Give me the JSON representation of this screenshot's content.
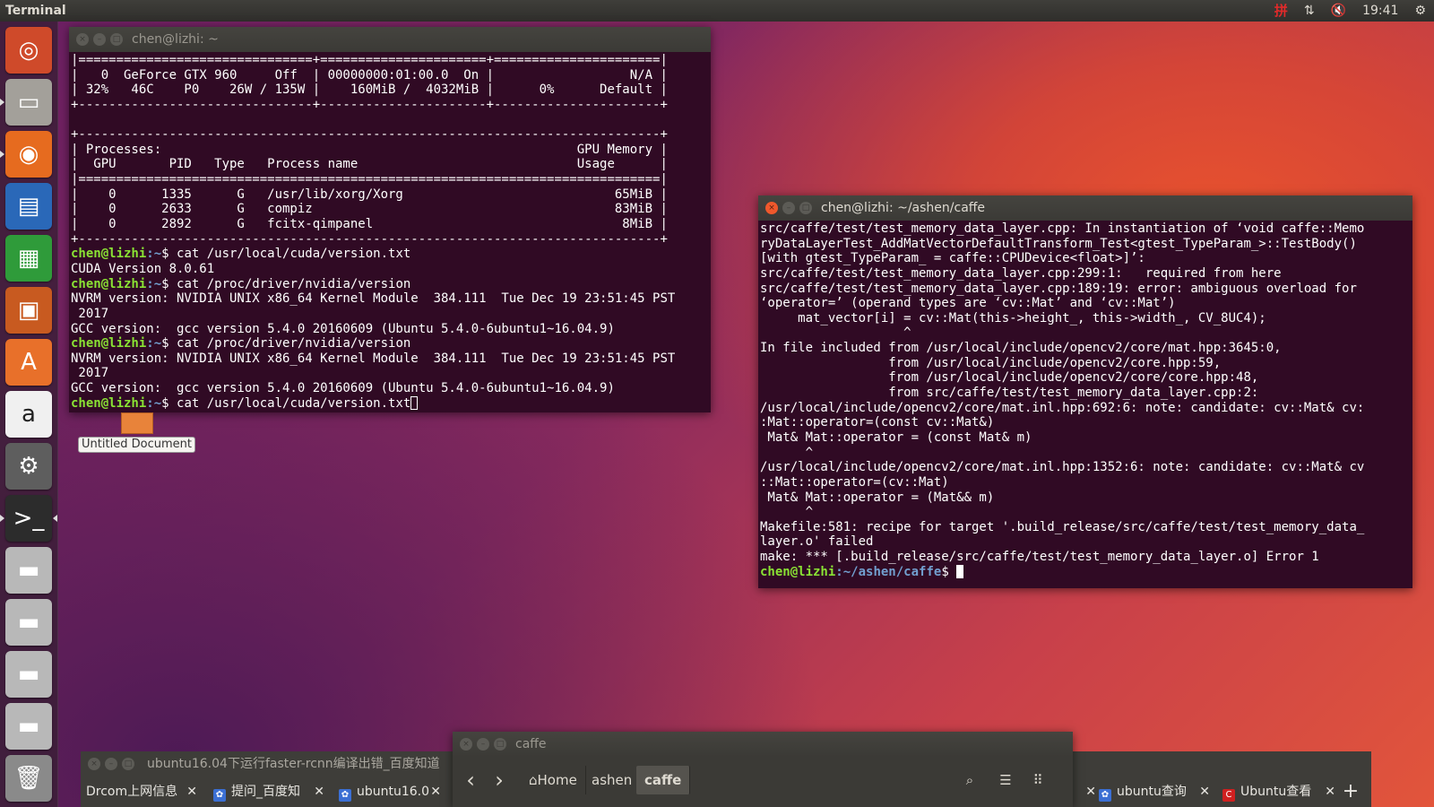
{
  "top_panel": {
    "app_title": "Terminal",
    "ime_label": "拼",
    "network_icon": "network-updown-icon",
    "volume_icon": "volume-muted-icon",
    "time": "19:41",
    "settings_icon": "gear-icon"
  },
  "launcher": {
    "items": [
      {
        "name": "ubuntu-dash-icon",
        "glyph": "◎",
        "bg": "#cf4a2a"
      },
      {
        "name": "files-icon",
        "glyph": "▭",
        "bg": "#a3a09a"
      },
      {
        "name": "firefox-icon",
        "glyph": "◉",
        "bg": "#e66b1f"
      },
      {
        "name": "libreoffice-writer-icon",
        "glyph": "▤",
        "bg": "#2a68b8"
      },
      {
        "name": "libreoffice-calc-icon",
        "glyph": "▦",
        "bg": "#2f9b3a"
      },
      {
        "name": "libreoffice-impress-icon",
        "glyph": "▣",
        "bg": "#c85a20"
      },
      {
        "name": "software-center-icon",
        "glyph": "A",
        "bg": "#e8702a"
      },
      {
        "name": "amazon-icon",
        "glyph": "a",
        "bg": "#f0f0f0"
      },
      {
        "name": "system-settings-icon",
        "glyph": "⚙",
        "bg": "#5e5e5e"
      },
      {
        "name": "terminal-icon",
        "glyph": ">_",
        "bg": "#2c2c2c"
      },
      {
        "name": "drive-icon",
        "glyph": "▬",
        "bg": "#b8b8b8"
      },
      {
        "name": "drive-icon",
        "glyph": "▬",
        "bg": "#b8b8b8"
      },
      {
        "name": "drive-icon",
        "glyph": "▬",
        "bg": "#b8b8b8"
      },
      {
        "name": "drive-icon",
        "glyph": "▬",
        "bg": "#b8b8b8"
      },
      {
        "name": "trash-icon",
        "glyph": "🗑",
        "bg": "#8a8a8a"
      }
    ]
  },
  "terminal1": {
    "title": "chen@lizhi: ~",
    "lines": [
      "|===============================+======================+======================|",
      "|   0  GeForce GTX 960     Off  | 00000000:01:00.0  On |                  N/A |",
      "| 32%   46C    P0    26W / 135W |    160MiB /  4032MiB |      0%      Default |",
      "+-------------------------------+----------------------+----------------------+",
      "",
      "+-----------------------------------------------------------------------------+",
      "| Processes:                                                       GPU Memory |",
      "|  GPU       PID   Type   Process name                             Usage      |",
      "|=============================================================================|",
      "|    0      1335      G   /usr/lib/xorg/Xorg                            65MiB |",
      "|    0      2633      G   compiz                                        83MiB |",
      "|    0      2892      G   fcitx-qimpanel                                 8MiB |",
      "+-----------------------------------------------------------------------------+"
    ],
    "after": [
      {
        "prompt_user": "chen@lizhi",
        "prompt_path": ":~",
        "prompt_end": "$ ",
        "cmd": "cat /usr/local/cuda/version.txt"
      },
      {
        "text": "CUDA Version 8.0.61"
      },
      {
        "prompt_user": "chen@lizhi",
        "prompt_path": ":~",
        "prompt_end": "$ ",
        "cmd": "cat /proc/driver/nvidia/version"
      },
      {
        "text": "NVRM version: NVIDIA UNIX x86_64 Kernel Module  384.111  Tue Dec 19 23:51:45 PST"
      },
      {
        "text": " 2017"
      },
      {
        "text": "GCC version:  gcc version 5.4.0 20160609 (Ubuntu 5.4.0-6ubuntu1~16.04.9)"
      },
      {
        "prompt_user": "chen@lizhi",
        "prompt_path": ":~",
        "prompt_end": "$ ",
        "cmd": "cat /proc/driver/nvidia/version"
      },
      {
        "text": "NVRM version: NVIDIA UNIX x86_64 Kernel Module  384.111  Tue Dec 19 23:51:45 PST"
      },
      {
        "text": " 2017"
      },
      {
        "text": "GCC version:  gcc version 5.4.0 20160609 (Ubuntu 5.4.0-6ubuntu1~16.04.9)"
      },
      {
        "prompt_user": "chen@lizhi",
        "prompt_path": ":~",
        "prompt_end": "$ ",
        "cmd": "cat /usr/local/cuda/version.txt",
        "cursor": "hollow"
      }
    ]
  },
  "terminal2": {
    "title": "chen@lizhi: ~/ashen/caffe",
    "lines": [
      "src/caffe/test/test_memory_data_layer.cpp: In instantiation of ‘void caffe::Memo",
      "ryDataLayerTest_AddMatVectorDefaultTransform_Test<gtest_TypeParam_>::TestBody()",
      "[with gtest_TypeParam_ = caffe::CPUDevice<float>]’:",
      "src/caffe/test/test_memory_data_layer.cpp:299:1:   required from here",
      "src/caffe/test/test_memory_data_layer.cpp:189:19: error: ambiguous overload for",
      "‘operator=’ (operand types are ‘cv::Mat’ and ‘cv::Mat’)",
      "     mat_vector[i] = cv::Mat(this->height_, this->width_, CV_8UC4);",
      "                   ^",
      "In file included from /usr/local/include/opencv2/core/mat.hpp:3645:0,",
      "                 from /usr/local/include/opencv2/core.hpp:59,",
      "                 from /usr/local/include/opencv2/core/core.hpp:48,",
      "                 from src/caffe/test/test_memory_data_layer.cpp:2:",
      "/usr/local/include/opencv2/core/mat.inl.hpp:692:6: note: candidate: cv::Mat& cv:",
      ":Mat::operator=(const cv::Mat&)",
      " Mat& Mat::operator = (const Mat& m)",
      "      ^",
      "/usr/local/include/opencv2/core/mat.inl.hpp:1352:6: note: candidate: cv::Mat& cv",
      "::Mat::operator=(cv::Mat)",
      " Mat& Mat::operator = (Mat&& m)",
      "      ^",
      "Makefile:581: recipe for target '.build_release/src/caffe/test/test_memory_data_",
      "layer.o' failed",
      "make: *** [.build_release/src/caffe/test/test_memory_data_layer.o] Error 1"
    ],
    "prompt": {
      "prompt_user": "chen@lizhi",
      "prompt_path": ":~/ashen/caffe",
      "prompt_end": "$ "
    }
  },
  "desktop": {
    "untitled_doc_label": "Untitled Document"
  },
  "browser": {
    "title": "ubuntu16.04下运行faster-rcnn编译出错_百度知道",
    "tabs": [
      {
        "label": "Drcom上网信息",
        "favicon": "globe-icon"
      },
      {
        "label": "提问_百度知",
        "favicon": "baidu-paw-icon"
      },
      {
        "label": "ubuntu16.0",
        "favicon": "baidu-paw-icon"
      },
      {
        "label": "ubuntu查询",
        "favicon": "baidu-paw-icon"
      },
      {
        "label": "Ubuntu查看",
        "favicon": "csdn-icon"
      }
    ],
    "new_tab": "+"
  },
  "nautilus": {
    "title": "caffe",
    "back": "‹",
    "forward": "›",
    "crumbs": [
      "Home",
      "ashen",
      "caffe"
    ],
    "search_icon": "search-icon",
    "list_icon": "list-view-icon",
    "grid_icon": "grid-view-icon"
  }
}
